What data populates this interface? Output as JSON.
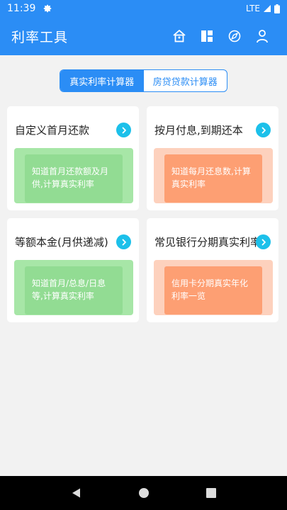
{
  "status_bar": {
    "time": "11:39",
    "network": "LTE"
  },
  "app_bar": {
    "title": "利率工具"
  },
  "tabs": [
    {
      "label": "真实利率计算器",
      "active": true
    },
    {
      "label": "房贷贷款计算器",
      "active": false
    }
  ],
  "cards": [
    {
      "title": "自定义首月还款",
      "description": "知道首月还款额及月供,计算真实利率",
      "color": "green"
    },
    {
      "title": "按月付息,到期还本",
      "description": "知道每月还息数,计算真实利率",
      "color": "orange"
    },
    {
      "title": "等额本金(月供递减)",
      "description": "知道首月/总息/日息等,计算真实利率",
      "color": "green"
    },
    {
      "title": "常见银行分期真实利率",
      "description": "信用卡分期真实年化利率一览",
      "color": "orange"
    }
  ],
  "colors": {
    "primary": "#2b8df5",
    "arrow": "#1cc0ea",
    "green_outer": "#a7e6a7",
    "green_inner": "#92dc93",
    "orange_outer": "#fdd1bd",
    "orange_inner": "#fd9f73"
  }
}
